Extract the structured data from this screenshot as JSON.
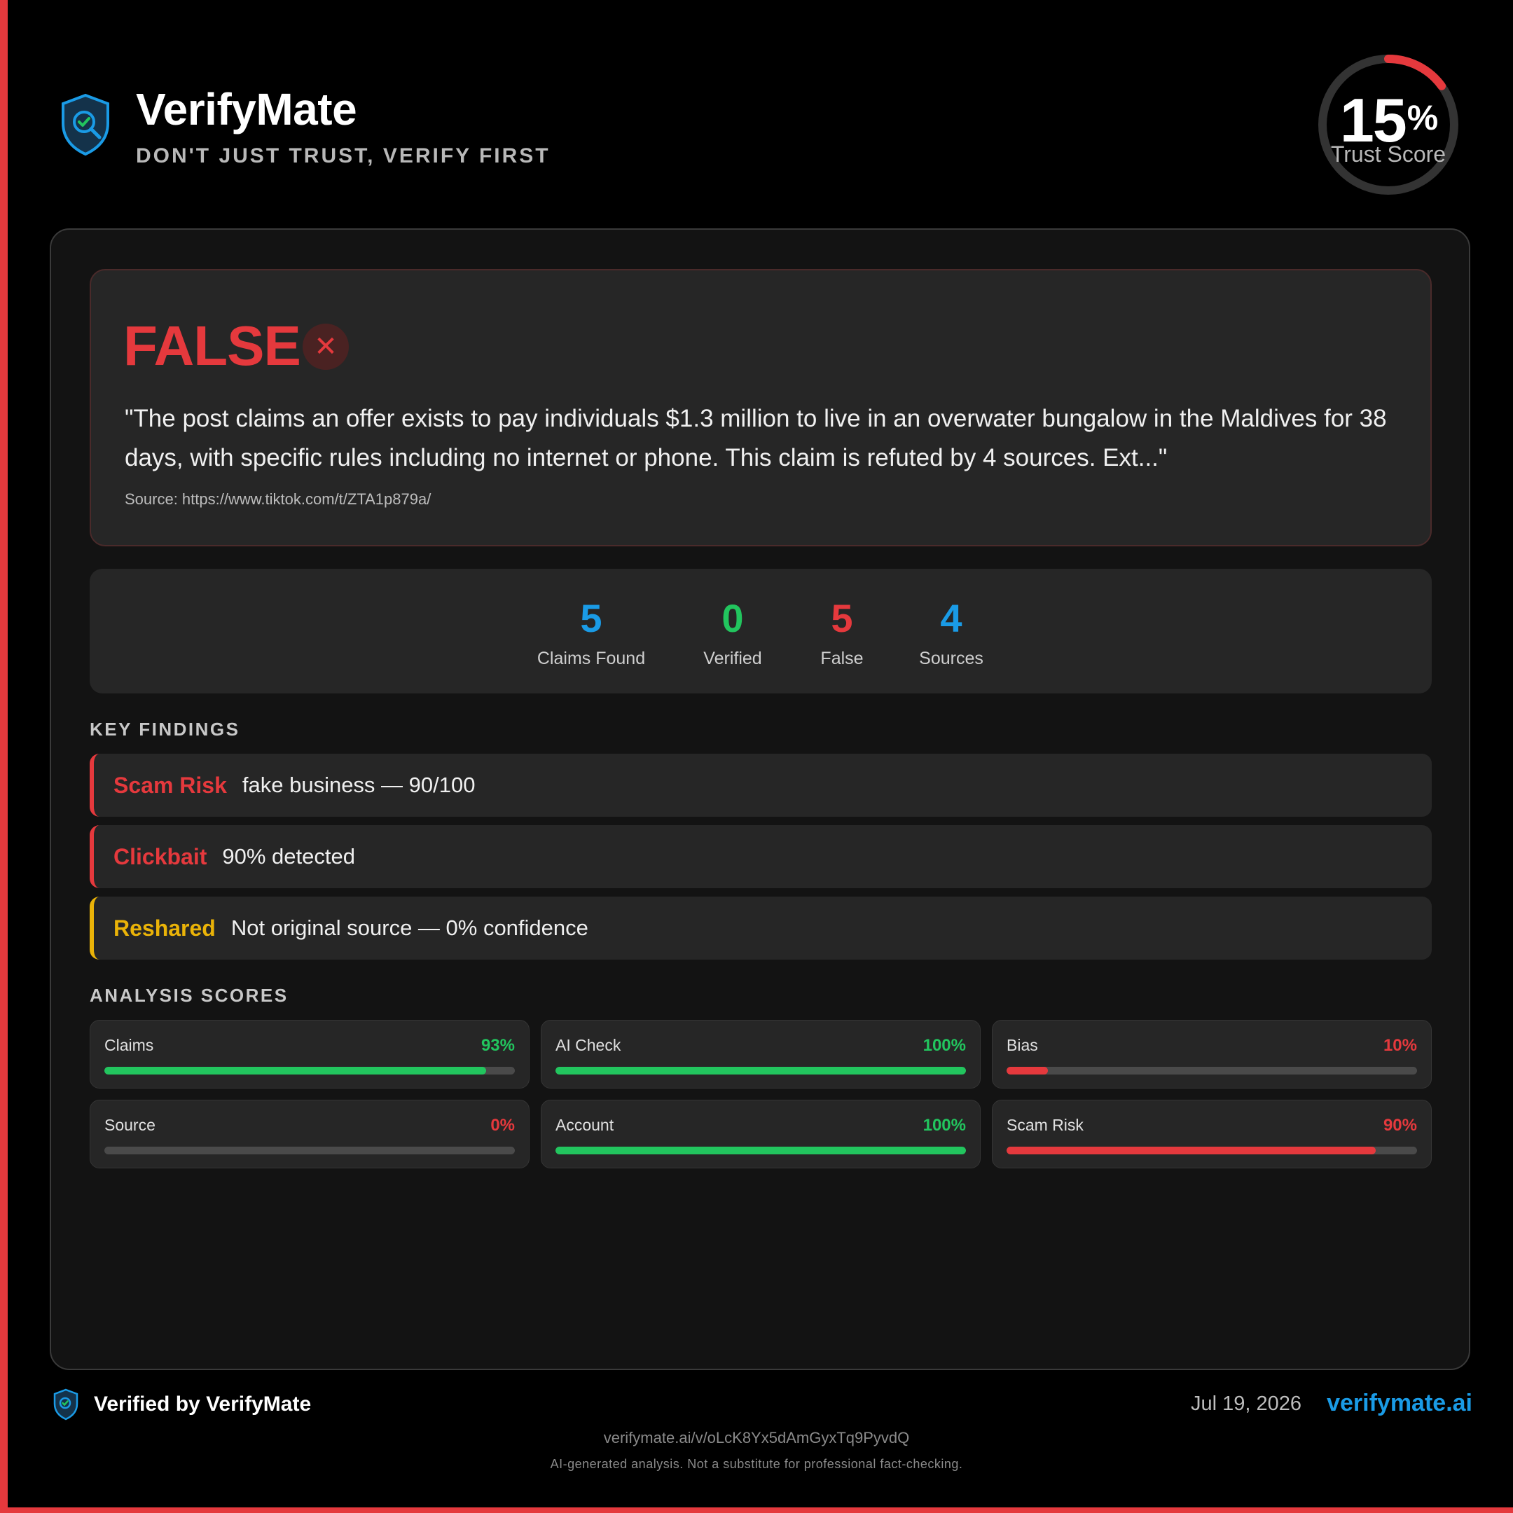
{
  "app": {
    "name": "VerifyMate",
    "tagline": "DON'T JUST TRUST, VERIFY FIRST",
    "brand_color": "#1a9be6"
  },
  "trust_score": {
    "value": 15,
    "value_text": "15",
    "unit": "%",
    "label": "Trust Score",
    "color": "#e5393d"
  },
  "verdict": {
    "label": "FALSE",
    "icon": "close-icon",
    "quote": "\"The post claims an offer exists to pay individuals $1.3 million to live in an overwater bungalow in the Maldives for 38 days, with specific rules including no internet or phone. This claim is refuted by 4 sources. Ext...\"",
    "source": "Source: https://www.tiktok.com/t/ZTA1p879a/"
  },
  "stats": [
    {
      "value": "5",
      "label": "Claims Found",
      "color": "#1a9be6"
    },
    {
      "value": "0",
      "label": "Verified",
      "color": "#22c55e"
    },
    {
      "value": "5",
      "label": "False",
      "color": "#e5393d"
    },
    {
      "value": "4",
      "label": "Sources",
      "color": "#1a9be6"
    }
  ],
  "key_findings": {
    "title": "KEY FINDINGS",
    "items": [
      {
        "key": "Scam Risk",
        "value": "fake business — 90/100",
        "color": "#e5393d"
      },
      {
        "key": "Clickbait",
        "value": "90% detected",
        "color": "#e5393d"
      },
      {
        "key": "Reshared",
        "value": "Not original source — 0% confidence",
        "color": "#eab308"
      }
    ]
  },
  "analysis_scores": {
    "title": "ANALYSIS SCORES",
    "items": [
      {
        "label": "Claims",
        "value": 93,
        "value_text": "93%",
        "color": "#22c55e"
      },
      {
        "label": "AI Check",
        "value": 100,
        "value_text": "100%",
        "color": "#22c55e"
      },
      {
        "label": "Bias",
        "value": 10,
        "value_text": "10%",
        "color": "#e5393d"
      },
      {
        "label": "Source",
        "value": 0,
        "value_text": "0%",
        "color": "#e5393d"
      },
      {
        "label": "Account",
        "value": 100,
        "value_text": "100%",
        "color": "#22c55e"
      },
      {
        "label": "Scam Risk",
        "value": 90,
        "value_text": "90%",
        "color": "#e5393d"
      }
    ]
  },
  "footer": {
    "verified_by": "Verified by VerifyMate",
    "date": "Jul 19, 2026",
    "domain": "verifymate.ai",
    "permalink": "verifymate.ai/v/oLcK8Yx5dAmGyxTq9PyvdQ",
    "disclaimer": "AI-generated analysis. Not a substitute for professional fact-checking."
  }
}
